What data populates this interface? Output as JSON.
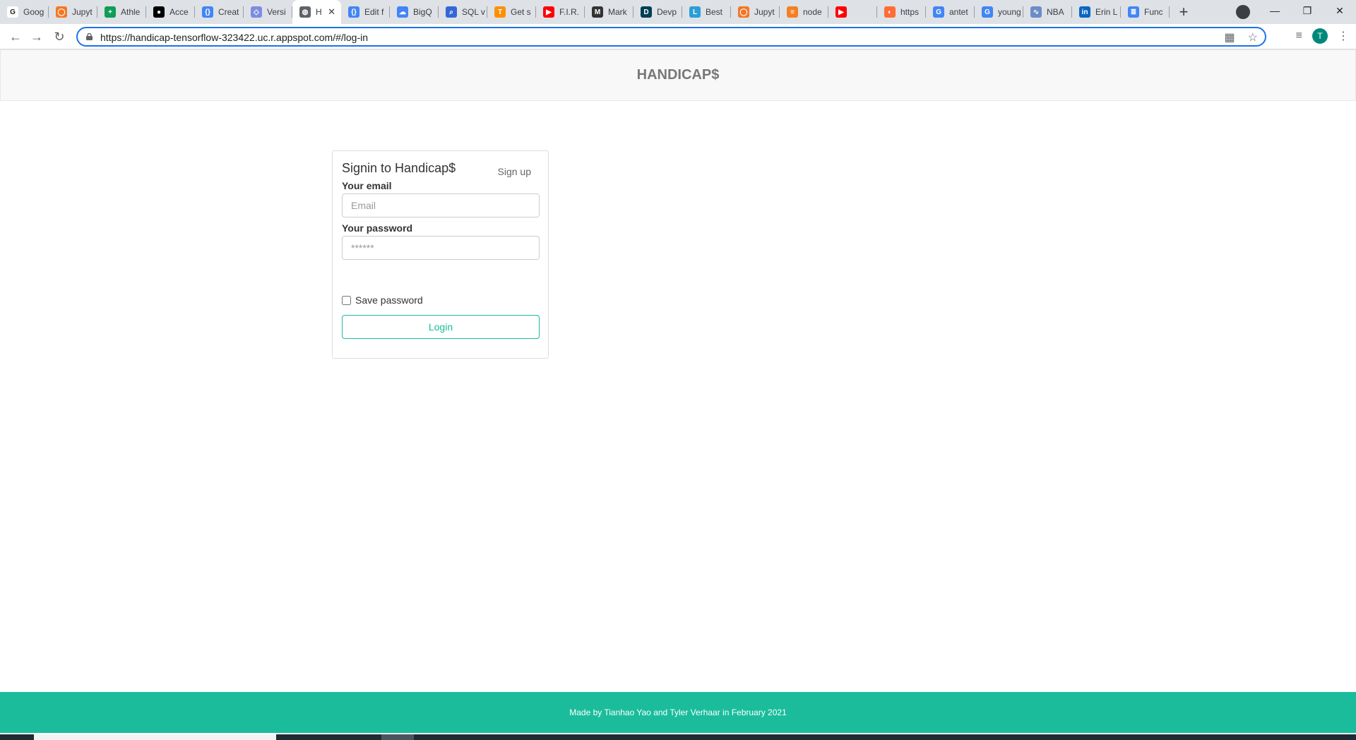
{
  "browser": {
    "tabs": [
      {
        "title": "Goog",
        "fav": "google-docs-icon",
        "color": "#ffffff",
        "glyph": "G"
      },
      {
        "title": "Jupyt",
        "fav": "jupyter-icon",
        "color": "#f37726",
        "glyph": "◯"
      },
      {
        "title": "Athle",
        "fav": "sheets-icon",
        "color": "#0f9d58",
        "glyph": "+"
      },
      {
        "title": "Acce",
        "fav": "medium-icon",
        "color": "#000000",
        "glyph": "●"
      },
      {
        "title": "Creat",
        "fav": "code-icon",
        "color": "#4285f4",
        "glyph": "{}"
      },
      {
        "title": "Versi",
        "fav": "network-icon",
        "color": "#7e8ce0",
        "glyph": "◇"
      },
      {
        "title": "H",
        "fav": "globe-icon",
        "color": "#5f6368",
        "glyph": "◍",
        "active": true
      },
      {
        "title": "Edit f",
        "fav": "code-icon",
        "color": "#4285f4",
        "glyph": "{}"
      },
      {
        "title": "BigQ",
        "fav": "cloud-icon",
        "color": "#4285f4",
        "glyph": "☁"
      },
      {
        "title": "SQL v",
        "fav": "search-icon",
        "color": "#3367d6",
        "glyph": "⌕"
      },
      {
        "title": "Get s",
        "fav": "tensorflow-icon",
        "color": "#ff8f00",
        "glyph": "T"
      },
      {
        "title": "F.I.R.",
        "fav": "youtube-icon",
        "color": "#ff0000",
        "glyph": "▶"
      },
      {
        "title": "Mark",
        "fav": "markdown-icon",
        "color": "#333333",
        "glyph": "M"
      },
      {
        "title": "Devp",
        "fav": "devpost-icon",
        "color": "#003e54",
        "glyph": "D"
      },
      {
        "title": "Best",
        "fav": "lucid-icon",
        "color": "#2a9fd6",
        "glyph": "L"
      },
      {
        "title": "Jupyt",
        "fav": "jupyter-icon",
        "color": "#f37726",
        "glyph": "◯"
      },
      {
        "title": "node",
        "fav": "stackoverflow-icon",
        "color": "#f48024",
        "glyph": "≡"
      },
      {
        "title": "",
        "fav": "youtube-icon",
        "color": "#ff0000",
        "glyph": "▶"
      },
      {
        "title": "https",
        "fav": "postman-icon",
        "color": "#ff6c37",
        "glyph": "◐"
      },
      {
        "title": "antet",
        "fav": "google-icon",
        "color": "#4285f4",
        "glyph": "G"
      },
      {
        "title": "young",
        "fav": "google-icon",
        "color": "#4285f4",
        "glyph": "G"
      },
      {
        "title": "NBA",
        "fav": "nba-icon",
        "color": "#6d8cc6",
        "glyph": "∿"
      },
      {
        "title": "Erin L",
        "fav": "linkedin-icon",
        "color": "#0a66c2",
        "glyph": "in"
      },
      {
        "title": "Func",
        "fav": "docs-icon",
        "color": "#4285f4",
        "glyph": "≣"
      }
    ],
    "url_label": "https://handicap-tensorflow-323422.uc.r.appspot.com/#/log-in",
    "avatar_letter": "T"
  },
  "header": {
    "brand": "HANDICAP$"
  },
  "login": {
    "title": "Signin to Handicap$",
    "signup_label": "Sign up",
    "email_label": "Your email",
    "email_placeholder": "Email",
    "password_label": "Your password",
    "password_placeholder": "******",
    "save_password_label": "Save password",
    "login_button": "Login"
  },
  "footer": {
    "text": "Made by Tianhao Yao and Tyler Verhaar in February 2021"
  },
  "colors": {
    "accent": "#18bc9c",
    "footer_bg": "#1abc9c",
    "header_bg": "#f8f8f8"
  }
}
